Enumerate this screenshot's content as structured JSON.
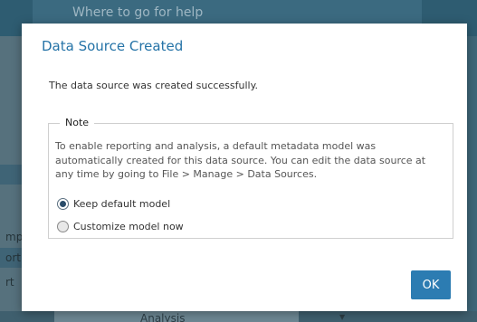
{
  "background": {
    "help_text": "Where to go for help",
    "fragments": [
      "mp",
      "ort",
      "rt"
    ],
    "bottom_field_text": "Analysis",
    "bottom_caret": "▼"
  },
  "dialog": {
    "title": "Data Source Created",
    "message": "The data source was created successfully.",
    "note": {
      "legend": "Note",
      "text": "To enable reporting and analysis, a default metadata model was automatically created for this data source. You can edit the data source at any time by going to File > Manage > Data Sources.",
      "options": [
        {
          "label": "Keep default model",
          "checked": true
        },
        {
          "label": "Customize model now",
          "checked": false
        }
      ]
    },
    "ok_label": "OK"
  },
  "colors": {
    "title": "#2573a7",
    "button": "#2c7cb2"
  }
}
